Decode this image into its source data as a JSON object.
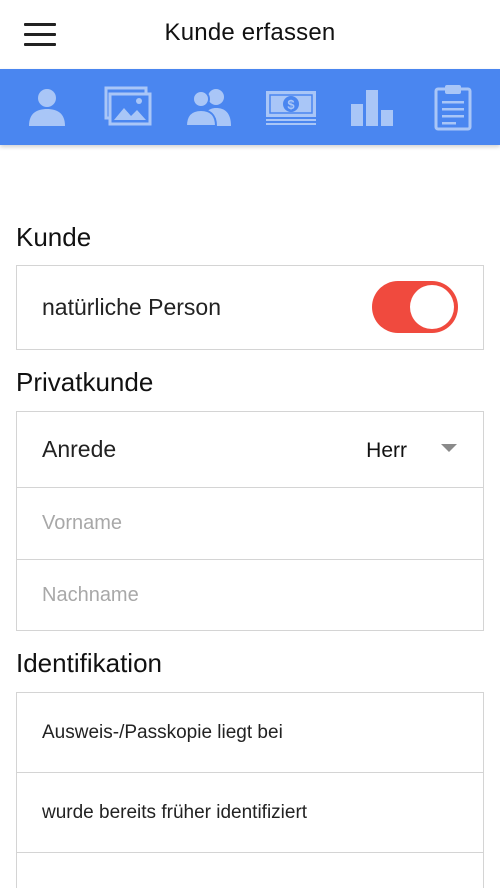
{
  "header": {
    "title": "Kunde erfassen",
    "menu_icon": "hamburger-menu-icon"
  },
  "tabs": [
    {
      "icon": "person-icon"
    },
    {
      "icon": "pictures-icon"
    },
    {
      "icon": "group-icon"
    },
    {
      "icon": "money-icon"
    },
    {
      "icon": "bar-chart-icon"
    },
    {
      "icon": "clipboard-icon"
    }
  ],
  "colors": {
    "tabbar": "#4a86f0",
    "toggle_on": "#f04a3e",
    "border": "#d4d4d4",
    "placeholder": "#a8a8a8"
  },
  "kunde": {
    "section_title": "Kunde",
    "natural_person_label": "natürliche Person",
    "natural_person_on": true
  },
  "privatkunde": {
    "section_title": "Privatkunde",
    "anrede_label": "Anrede",
    "anrede_value": "Herr",
    "vorname_placeholder": "Vorname",
    "nachname_placeholder": "Nachname"
  },
  "identifikation": {
    "section_title": "Identifikation",
    "options": [
      "Ausweis-/Passkopie liegt bei",
      "wurde bereits früher identifiziert"
    ]
  }
}
